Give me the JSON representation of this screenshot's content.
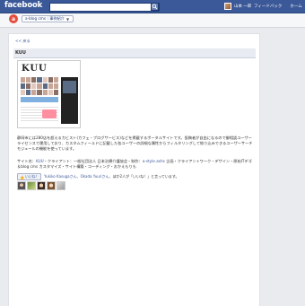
{
  "topbar": {
    "logo": "facebook",
    "user_name": "山本 一郎",
    "nav": [
      "フィードバック",
      "ホーム"
    ]
  },
  "header": {
    "app_icon_glyph": "a",
    "breadcrumb": "a-blog cms｜事例紹介",
    "breadcrumb_arrow": "▼"
  },
  "post": {
    "back_link": "<< 戻る",
    "title": "KUU",
    "thumbnail_logo": "KUU",
    "body": "静岡市には280店を超えるカビスト(カフェ・ブログサービス)などを掲載するポータルサイトです。投稿者が自由になるので御相談ユーザーライセンスで運用しており、カスタムフィールドに記載した各ユーザーの詳細な属性からフィルタリングして絞り込みできるユーザーサーチモジュールの機能を使っています。",
    "tags_prefix": "サイト名：",
    "tags_site": "KUU",
    "tags_mid1": "・クライアント：一般社団法人 日本治療介護協会・制作：",
    "tags_agency": "a-style.ashs",
    "tags_rest": " 企画・クライアントワーク・デザイン・原始ITデゴ＆blog cms カスタマイズ・サイト構築・コーディング・おかえもりも",
    "like_label": "いいね！",
    "like_names": "Yukiko Kasugaさん、Okada Yuuriさん",
    "like_suffix": "、ほか2人が「いいね！」と言っています。"
  },
  "icons": {
    "search": "search-icon",
    "like": "thumbs-up-icon"
  },
  "colors": {
    "brand": "#3b5998",
    "app_icon": "#e64c3c"
  }
}
